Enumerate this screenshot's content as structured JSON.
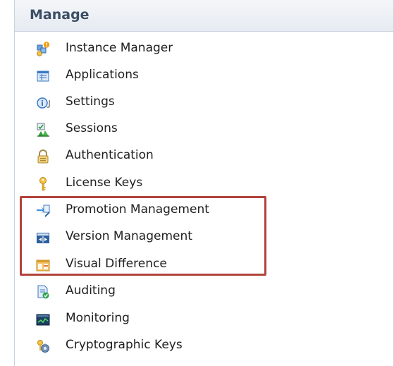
{
  "panel": {
    "title": "Manage",
    "items": [
      {
        "label": "Instance Manager",
        "icon": "instance-manager-icon"
      },
      {
        "label": "Applications",
        "icon": "applications-icon"
      },
      {
        "label": "Settings",
        "icon": "settings-icon"
      },
      {
        "label": "Sessions",
        "icon": "sessions-icon"
      },
      {
        "label": "Authentication",
        "icon": "lock-icon"
      },
      {
        "label": "License Keys",
        "icon": "key-icon"
      },
      {
        "label": "Promotion Management",
        "icon": "promotion-icon"
      },
      {
        "label": "Version Management",
        "icon": "version-icon"
      },
      {
        "label": "Visual Difference",
        "icon": "visual-difference-icon"
      },
      {
        "label": "Auditing",
        "icon": "auditing-icon"
      },
      {
        "label": "Monitoring",
        "icon": "monitoring-icon"
      },
      {
        "label": "Cryptographic Keys",
        "icon": "cryptographic-keys-icon"
      }
    ]
  },
  "colors": {
    "header_text": "#3b4e66",
    "highlight_border": "#b1433c",
    "panel_border": "#c9d3df"
  }
}
